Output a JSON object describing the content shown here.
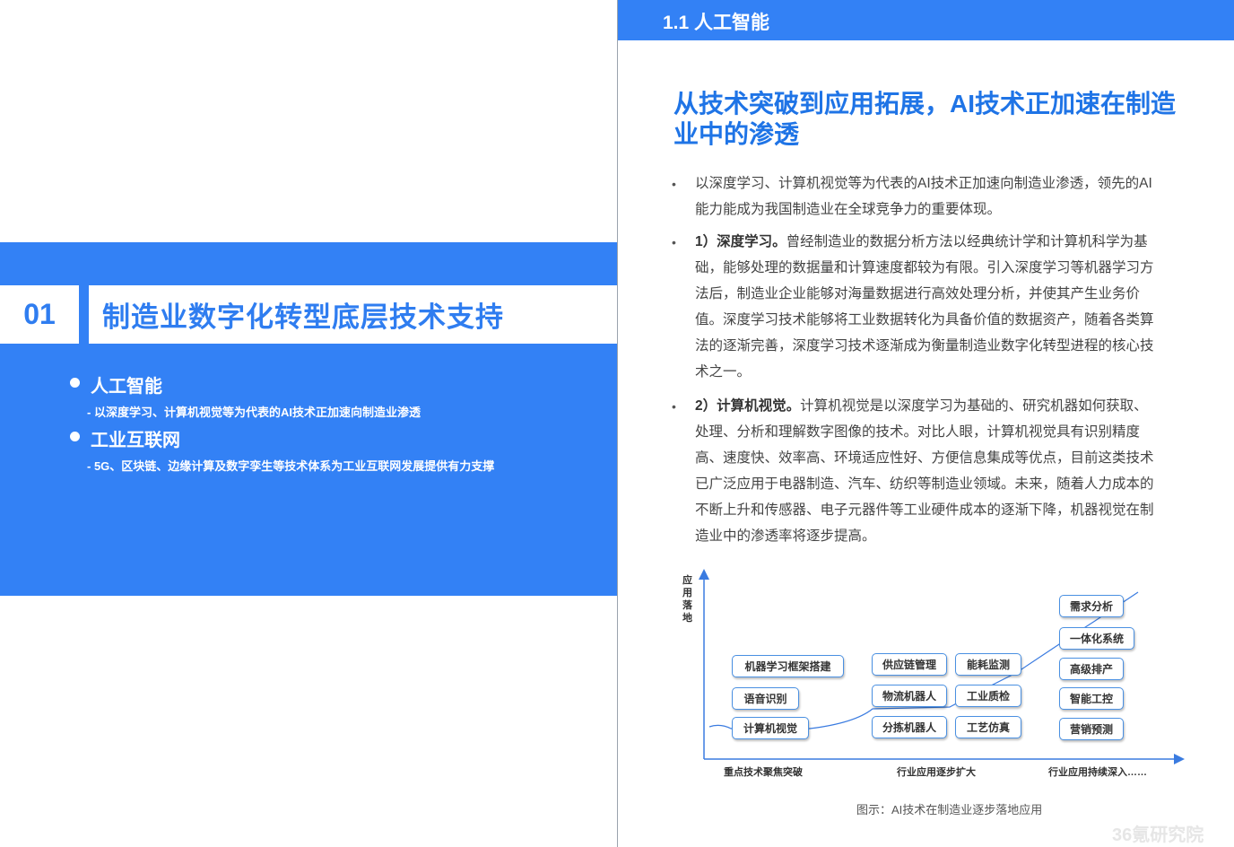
{
  "left_page": {
    "section_number": "01",
    "section_title": "制造业数字化转型底层技术支持",
    "bullets": [
      {
        "heading": "人工智能",
        "sub": "- 以深度学习、计算机视觉等为代表的AI技术正加速向制造业渗透"
      },
      {
        "heading": "工业互联网",
        "sub": "- 5G、区块链、边缘计算及数字孪生等技术体系为工业互联网发展提供有力支撑"
      }
    ]
  },
  "right_page": {
    "header": "1.1 人工智能",
    "title_line1": "从技术突破到应用拓展，AI技术正加速在制造",
    "title_line2": "业中的渗透",
    "paragraphs": [
      {
        "lines": [
          "以深度学习、计算机视觉等为代表的AI技术正加速向制造业渗透，领先的AI",
          "能力能成为我国制造业在全球竞争力的重要体现。"
        ]
      },
      {
        "lead": "1）深度学习。",
        "lines": [
          "曾经制造业的数据分析方法以经典统计学和计算机科学为基",
          "础，能够处理的数据量和计算速度都较为有限。引入深度学习等机器学习方",
          "法后，制造业企业能够对海量数据进行高效处理分析，并使其产生业务价",
          "值。深度学习技术能够将工业数据转化为具备价值的数据资产，随着各类算",
          "法的逐渐完善，深度学习技术逐渐成为衡量制造业数字化转型进程的核心技",
          "术之一。"
        ]
      },
      {
        "lead": "2）计算机视觉。",
        "lines": [
          "计算机视觉是以深度学习为基础的、研究机器如何获取、",
          "处理、分析和理解数字图像的技术。对比人眼，计算机视觉具有识别精度",
          "高、速度快、效率高、环境适应性好、方便信息集成等优点，目前这类技术",
          "已广泛应用于电器制造、汽车、纺织等制造业领域。未来，随着人力成本的",
          "不断上升和传感器、电子元器件等工业硬件成本的逐渐下降，机器视觉在制",
          "造业中的渗透率将逐步提高。"
        ]
      }
    ],
    "diagram": {
      "y_axis_label": "应用落地",
      "x_stages": [
        "重点技术聚焦突破",
        "行业应用逐步扩大",
        "行业应用持续深入……"
      ],
      "col1": [
        "机器学习框架搭建",
        "语音识别",
        "计算机视觉"
      ],
      "col2a": [
        "供应链管理",
        "物流机器人",
        "分拣机器人"
      ],
      "col2b": [
        "能耗监测",
        "工业质检",
        "工艺仿真"
      ],
      "col3": [
        "需求分析",
        "一体化系统",
        "高级排产",
        "智能工控",
        "营销预测"
      ]
    },
    "caption": "图示：AI技术在制造业逐步落地应用",
    "watermark": "36氪研究院"
  }
}
